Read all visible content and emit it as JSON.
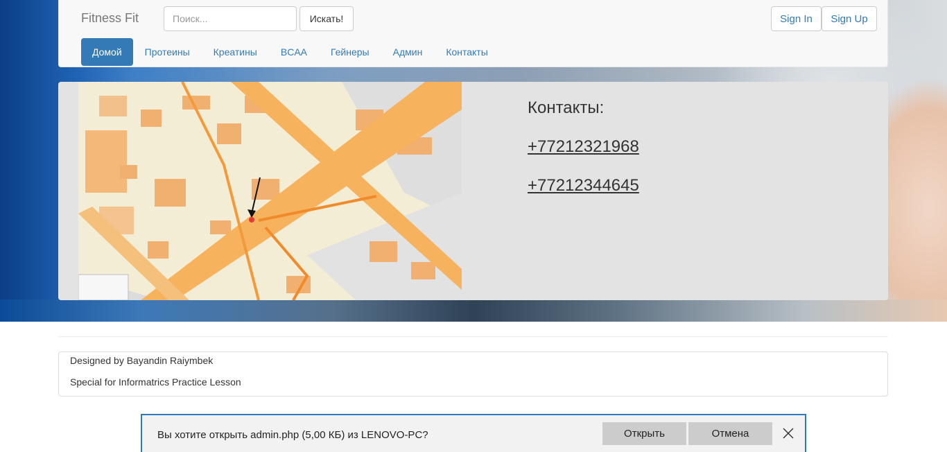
{
  "navbar": {
    "brand": "Fitness Fit",
    "search_placeholder": "Поиск...",
    "search_button": "Искать!",
    "signin": "Sign In",
    "signup": "Sign Up",
    "tabs": [
      {
        "label": "Домой",
        "active": true
      },
      {
        "label": "Протеины",
        "active": false
      },
      {
        "label": "Креатины",
        "active": false
      },
      {
        "label": "BCAA",
        "active": false
      },
      {
        "label": "Гейнеры",
        "active": false
      },
      {
        "label": "Админ",
        "active": false
      },
      {
        "label": "Контакты",
        "active": false
      }
    ]
  },
  "contacts": {
    "title": "Контакты:",
    "phones": [
      "+77212321968",
      "+77212344645"
    ]
  },
  "footer": {
    "line1": "Designed by Bayandin Raiymbek",
    "line2": "Special for Informatrics Practice Lesson"
  },
  "download_prompt": {
    "message": "Вы хотите открыть admin.php (5,00 КБ) из LENOVO-PC?",
    "open": "Открыть",
    "cancel": "Отмена"
  },
  "colors": {
    "accent": "#337ab7",
    "jumbotron": "#e3e3e3",
    "download_border": "#2a7bc4"
  }
}
